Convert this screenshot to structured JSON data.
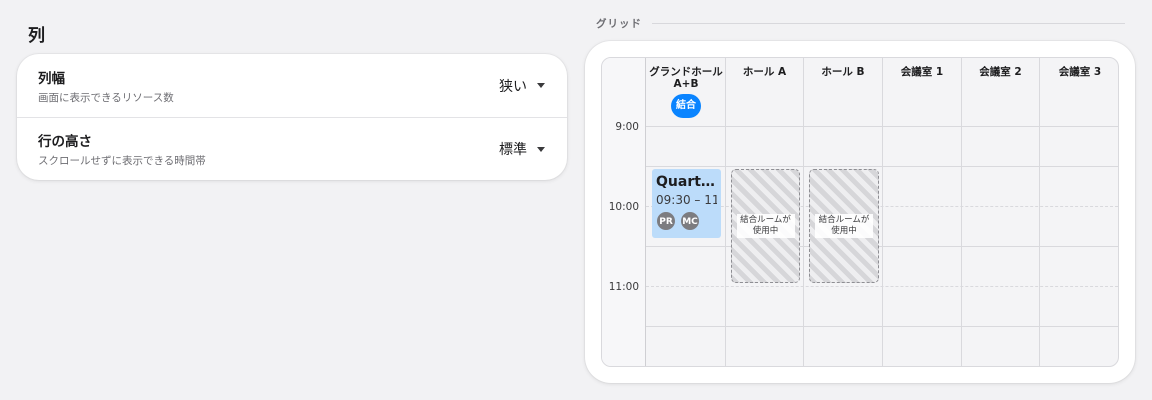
{
  "columns_section": {
    "title": "列",
    "settings": [
      {
        "label": "列幅",
        "description": "画面に表示できるリソース数",
        "value": "狭い"
      },
      {
        "label": "行の高さ",
        "description": "スクロールせずに表示できる時間帯",
        "value": "標準"
      }
    ]
  },
  "grid_section": {
    "heading": "グリッド",
    "resources": [
      {
        "name": "グランドホール A+B",
        "badge": "結合"
      },
      {
        "name": "ホール A"
      },
      {
        "name": "ホール B"
      },
      {
        "name": "会議室 1"
      },
      {
        "name": "会議室 2"
      },
      {
        "name": "会議室 3"
      }
    ],
    "times": [
      "9:00",
      "10:00",
      "11:00"
    ],
    "event": {
      "title": "Quart…",
      "time": "09:30 – 11:",
      "attendees": [
        "PR",
        "MC"
      ]
    },
    "blocked_label": "結合ルームが使用中",
    "colors": {
      "accent": "#0a84ff",
      "event_bg": "#bcdcfa",
      "avatar_bg": "#7c7c80"
    }
  }
}
